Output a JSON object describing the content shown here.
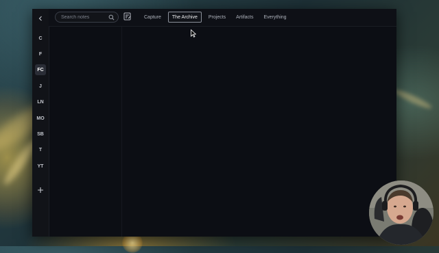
{
  "sidebar": {
    "items": [
      {
        "label": "C",
        "active": false
      },
      {
        "label": "F",
        "active": false
      },
      {
        "label": "FC",
        "active": true
      },
      {
        "label": "J",
        "active": false
      },
      {
        "label": "LN",
        "active": false
      },
      {
        "label": "MO",
        "active": false
      },
      {
        "label": "SB",
        "active": false
      },
      {
        "label": "T",
        "active": false
      },
      {
        "label": "YT",
        "active": false
      }
    ],
    "back_icon": "chevron-left-icon",
    "add_icon": "plus-icon"
  },
  "search": {
    "placeholder": "Search notes",
    "value": "",
    "icon": "search-icon"
  },
  "toolbar": {
    "new_note_icon": "edit-note-icon"
  },
  "tabs": [
    {
      "label": "Capture",
      "active": false
    },
    {
      "label": "The Archive",
      "active": true
    },
    {
      "label": "Projects",
      "active": false
    },
    {
      "label": "Artifacts",
      "active": false
    },
    {
      "label": "Everything",
      "active": false
    }
  ],
  "colors": {
    "window_bg": "#0c0e14",
    "rail_bg": "#111318",
    "active_tab_border": "#8d929c",
    "text_muted": "#aeb3bc"
  }
}
